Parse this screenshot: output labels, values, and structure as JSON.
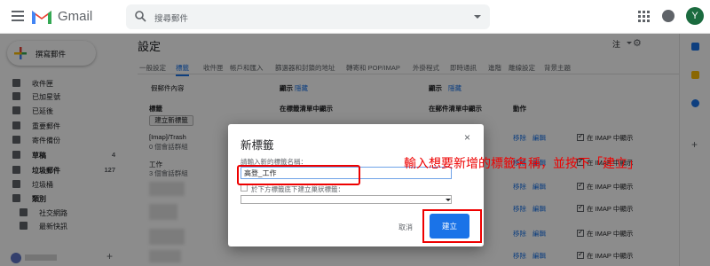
{
  "topbar": {
    "app_name": "Gmail",
    "search_placeholder": "搜尋郵件",
    "avatar_letter": "Y"
  },
  "sidebar": {
    "compose_label": "撰寫郵件",
    "items": [
      {
        "label": "收件匣",
        "count": "",
        "icon": "inbox-icon",
        "bold": false
      },
      {
        "label": "已加星號",
        "count": "",
        "icon": "star-icon",
        "bold": false
      },
      {
        "label": "已延後",
        "count": "",
        "icon": "clock-icon",
        "bold": false
      },
      {
        "label": "重要郵件",
        "count": "",
        "icon": "important-icon",
        "bold": false
      },
      {
        "label": "寄件備份",
        "count": "",
        "icon": "send-icon",
        "bold": false
      },
      {
        "label": "草稿",
        "count": "4",
        "icon": "draft-icon",
        "bold": true
      },
      {
        "label": "垃圾郵件",
        "count": "127",
        "icon": "spam-icon",
        "bold": true
      },
      {
        "label": "垃圾桶",
        "count": "",
        "icon": "trash-icon",
        "bold": false
      },
      {
        "label": "類別",
        "count": "",
        "icon": "label-icon",
        "bold": true
      },
      {
        "label": "社交網路",
        "count": "",
        "icon": "people-icon",
        "bold": false
      },
      {
        "label": "最新快訊",
        "count": "",
        "icon": "info-icon",
        "bold": false
      }
    ],
    "add_label": "+"
  },
  "main": {
    "title": "設定",
    "lang": "注",
    "tabs": [
      "一般設定",
      "標籤",
      "收件匣",
      "帳戶和匯入",
      "篩選器和封鎖的地址",
      "轉寄和 POP/IMAP",
      "外掛程式",
      "即時通訊",
      "進階",
      "離線設定",
      "背景主題"
    ],
    "row1": {
      "left": "假郵件內容",
      "show1": "顯示",
      "hide1": "隱藏",
      "show2": "顯示",
      "hide2": "隱藏"
    },
    "headers": {
      "labels": "標籤",
      "in_label_list": "在標籤清單中顯示",
      "in_msg_list": "在郵件清單中顯示",
      "actions": "動作"
    },
    "new_label_btn": "建立新標籤",
    "labels": [
      {
        "name": "[Imap]/Trash",
        "sub": "0 個會話群組"
      },
      {
        "name": "工作",
        "sub": "3 個會話群組"
      }
    ],
    "actions": {
      "remove": "移除",
      "edit": "編輯",
      "imap": "在 IMAP 中顯示"
    }
  },
  "dialog": {
    "title": "新標籤",
    "close": "×",
    "field_label": "請輸入新的標籤名稱：",
    "field_value": "高登_工作",
    "nest_label": "於下方標籤底下建立巢狀標籤：",
    "cancel": "取消",
    "create": "建立"
  },
  "annotation": "輸入想要新增的標籤名稱，並按下「建立」",
  "colors": {
    "accent": "#1a73e8",
    "annotation_red": "#e00000",
    "avatar_green": "#1b6b3f"
  }
}
